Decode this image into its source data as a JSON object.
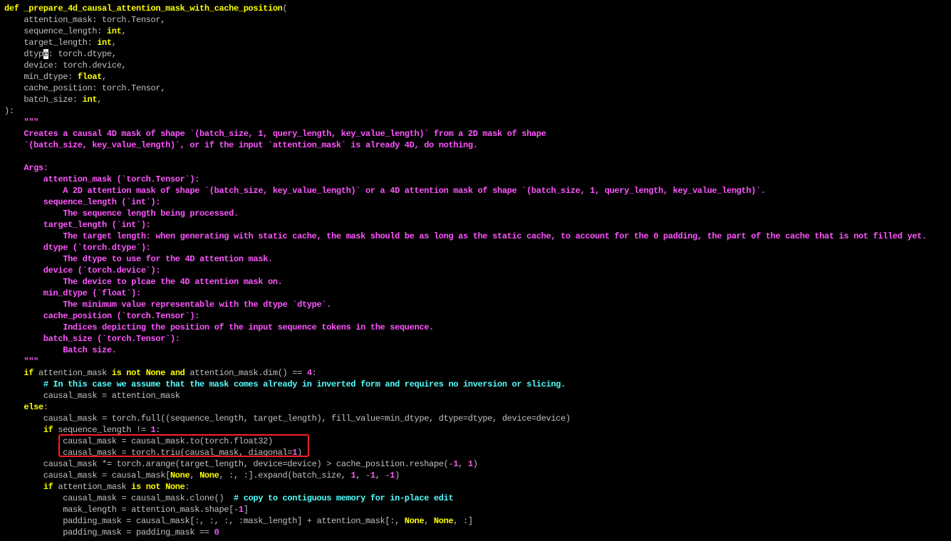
{
  "colors": {
    "background": "#000000",
    "plain": "#c0c0c0",
    "keyword": "#ffff00",
    "docstring": "#ff55ff",
    "comment": "#55ffff",
    "highlight_border": "#ff2020"
  },
  "editor": {
    "lines": [
      [
        {
          "t": "def ",
          "c": "kw"
        },
        {
          "t": "_prepare_4d_causal_attention_mask_with_cache_position",
          "c": "fn"
        },
        {
          "t": "(",
          "c": "plain"
        }
      ],
      [
        {
          "t": "    attention_mask: torch.Tensor,",
          "c": "plain"
        }
      ],
      [
        {
          "t": "    sequence_length: ",
          "c": "plain"
        },
        {
          "t": "int",
          "c": "type"
        },
        {
          "t": ",",
          "c": "plain"
        }
      ],
      [
        {
          "t": "    target_length: ",
          "c": "plain"
        },
        {
          "t": "int",
          "c": "type"
        },
        {
          "t": ",",
          "c": "plain"
        }
      ],
      [
        {
          "t": "    dtyp",
          "c": "plain"
        },
        {
          "t": "e",
          "c": "cursor"
        },
        {
          "t": ": torch.dtype,",
          "c": "plain"
        }
      ],
      [
        {
          "t": "    device: torch.device,",
          "c": "plain"
        }
      ],
      [
        {
          "t": "    min_dtype: ",
          "c": "plain"
        },
        {
          "t": "float",
          "c": "type"
        },
        {
          "t": ",",
          "c": "plain"
        }
      ],
      [
        {
          "t": "    cache_position: torch.Tensor,",
          "c": "plain"
        }
      ],
      [
        {
          "t": "    batch_size: ",
          "c": "plain"
        },
        {
          "t": "int",
          "c": "type"
        },
        {
          "t": ",",
          "c": "plain"
        }
      ],
      [
        {
          "t": "):",
          "c": "plain"
        }
      ],
      [
        {
          "t": "    \"\"\"",
          "c": "doc"
        }
      ],
      [
        {
          "t": "    Creates a causal 4D mask of shape `(batch_size, 1, query_length, key_value_length)` from a 2D mask of shape",
          "c": "doc"
        }
      ],
      [
        {
          "t": "    `(batch_size, key_value_length)`, or if the input `attention_mask` is already 4D, do nothing.",
          "c": "doc"
        }
      ],
      [
        {
          "t": "",
          "c": "plain"
        }
      ],
      [
        {
          "t": "    Args:",
          "c": "doc"
        }
      ],
      [
        {
          "t": "        attention_mask (`torch.Tensor`):",
          "c": "doc"
        }
      ],
      [
        {
          "t": "            A 2D attention mask of shape `(batch_size, key_value_length)` or a 4D attention mask of shape `(batch_size, 1, query_length, key_value_length)`.",
          "c": "doc"
        }
      ],
      [
        {
          "t": "        sequence_length (`int`):",
          "c": "doc"
        }
      ],
      [
        {
          "t": "            The sequence length being processed.",
          "c": "doc"
        }
      ],
      [
        {
          "t": "        target_length (`int`):",
          "c": "doc"
        }
      ],
      [
        {
          "t": "            The target length: when generating with static cache, the mask should be as long as the static cache, to account for the 0 padding, the part of the cache that is not filled yet.",
          "c": "doc"
        }
      ],
      [
        {
          "t": "        dtype (`torch.dtype`):",
          "c": "doc"
        }
      ],
      [
        {
          "t": "            The dtype to use for the 4D attention mask.",
          "c": "doc"
        }
      ],
      [
        {
          "t": "        device (`torch.device`):",
          "c": "doc"
        }
      ],
      [
        {
          "t": "            The device to plcae the 4D attention mask on.",
          "c": "doc"
        }
      ],
      [
        {
          "t": "        min_dtype (`float`):",
          "c": "doc"
        }
      ],
      [
        {
          "t": "            The minimum value representable with the dtype `dtype`.",
          "c": "doc"
        }
      ],
      [
        {
          "t": "        cache_position (`torch.Tensor`):",
          "c": "doc"
        }
      ],
      [
        {
          "t": "            Indices depicting the position of the input sequence tokens in the sequence.",
          "c": "doc"
        }
      ],
      [
        {
          "t": "        batch_size (`torch.Tensor`):",
          "c": "doc"
        }
      ],
      [
        {
          "t": "            Batch size.",
          "c": "doc"
        }
      ],
      [
        {
          "t": "    \"\"\"",
          "c": "doc"
        }
      ],
      [
        {
          "t": "    ",
          "c": "plain"
        },
        {
          "t": "if",
          "c": "kw"
        },
        {
          "t": " attention_mask ",
          "c": "plain"
        },
        {
          "t": "is not",
          "c": "kw"
        },
        {
          "t": " ",
          "c": "plain"
        },
        {
          "t": "None",
          "c": "const"
        },
        {
          "t": " ",
          "c": "plain"
        },
        {
          "t": "and",
          "c": "kw"
        },
        {
          "t": " attention_mask.dim() == ",
          "c": "plain"
        },
        {
          "t": "4",
          "c": "num"
        },
        {
          "t": ":",
          "c": "plain"
        }
      ],
      [
        {
          "t": "        ",
          "c": "plain"
        },
        {
          "t": "# In this case we assume that the mask comes already in inverted form and requires no inversion or slicing.",
          "c": "comment"
        }
      ],
      [
        {
          "t": "        causal_mask = attention_mask",
          "c": "plain"
        }
      ],
      [
        {
          "t": "    ",
          "c": "plain"
        },
        {
          "t": "else",
          "c": "kw"
        },
        {
          "t": ":",
          "c": "plain"
        }
      ],
      [
        {
          "t": "        causal_mask = torch.full((sequence_length, target_length), fill_value=min_dtype, dtype=dtype, device=device)",
          "c": "plain"
        }
      ],
      [
        {
          "t": "        ",
          "c": "plain"
        },
        {
          "t": "if",
          "c": "kw"
        },
        {
          "t": " sequence_length != ",
          "c": "plain"
        },
        {
          "t": "1",
          "c": "num"
        },
        {
          "t": ":",
          "c": "plain"
        }
      ],
      [
        {
          "t": "            causal_mask = causal_mask.to(torch.float32)",
          "c": "plain"
        }
      ],
      [
        {
          "t": "            causal_mask = torch.triu(causal_mask, diagonal=",
          "c": "plain"
        },
        {
          "t": "1",
          "c": "num"
        },
        {
          "t": ")",
          "c": "plain"
        }
      ],
      [
        {
          "t": "        causal_mask *= torch.arange(target_length, device=device) > cache_position.reshape(-",
          "c": "plain"
        },
        {
          "t": "1",
          "c": "num"
        },
        {
          "t": ", ",
          "c": "plain"
        },
        {
          "t": "1",
          "c": "num"
        },
        {
          "t": ")",
          "c": "plain"
        }
      ],
      [
        {
          "t": "        causal_mask = causal_mask[",
          "c": "plain"
        },
        {
          "t": "None",
          "c": "const"
        },
        {
          "t": ", ",
          "c": "plain"
        },
        {
          "t": "None",
          "c": "const"
        },
        {
          "t": ", :, :].expand(batch_size, ",
          "c": "plain"
        },
        {
          "t": "1",
          "c": "num"
        },
        {
          "t": ", -",
          "c": "plain"
        },
        {
          "t": "1",
          "c": "num"
        },
        {
          "t": ", -",
          "c": "plain"
        },
        {
          "t": "1",
          "c": "num"
        },
        {
          "t": ")",
          "c": "plain"
        }
      ],
      [
        {
          "t": "        ",
          "c": "plain"
        },
        {
          "t": "if",
          "c": "kw"
        },
        {
          "t": " attention_mask ",
          "c": "plain"
        },
        {
          "t": "is not",
          "c": "kw"
        },
        {
          "t": " ",
          "c": "plain"
        },
        {
          "t": "None",
          "c": "const"
        },
        {
          "t": ":",
          "c": "plain"
        }
      ],
      [
        {
          "t": "            causal_mask = causal_mask.clone()  ",
          "c": "plain"
        },
        {
          "t": "# copy to contiguous memory for in-place edit",
          "c": "comment"
        }
      ],
      [
        {
          "t": "            mask_length = attention_mask.shape[-",
          "c": "plain"
        },
        {
          "t": "1",
          "c": "num"
        },
        {
          "t": "]",
          "c": "plain"
        }
      ],
      [
        {
          "t": "            padding_mask = causal_mask[:, :, :, :mask_length] + attention_mask[:, ",
          "c": "plain"
        },
        {
          "t": "None",
          "c": "const"
        },
        {
          "t": ", ",
          "c": "plain"
        },
        {
          "t": "None",
          "c": "const"
        },
        {
          "t": ", :]",
          "c": "plain"
        }
      ],
      [
        {
          "t": "            padding_mask = padding_mask == ",
          "c": "plain"
        },
        {
          "t": "0",
          "c": "num"
        }
      ]
    ]
  }
}
